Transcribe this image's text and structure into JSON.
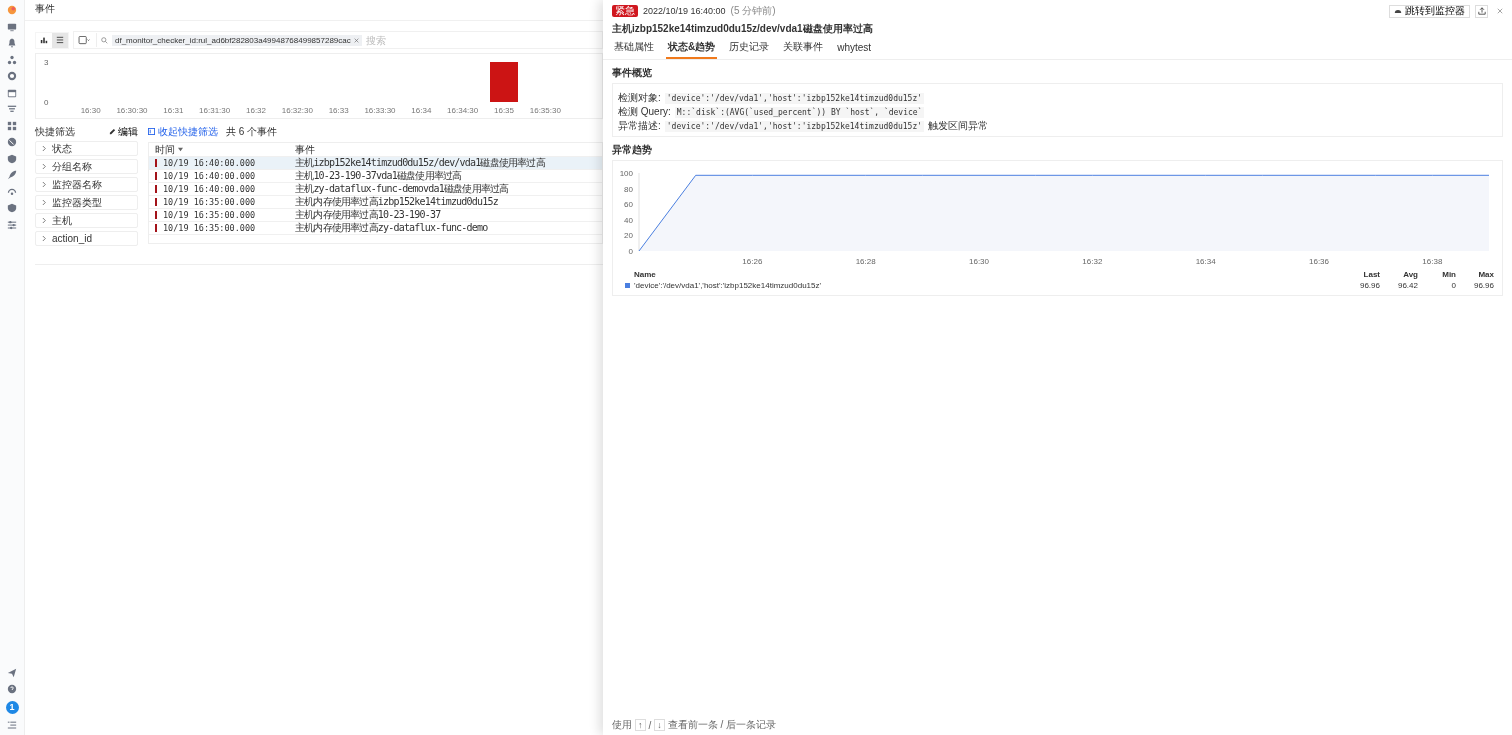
{
  "nav": {
    "badge": "1"
  },
  "header": {
    "title": "事件"
  },
  "toolbar": {
    "views": [
      {
        "kind": "chart",
        "selected": false
      },
      {
        "kind": "list",
        "selected": true
      }
    ],
    "filter_tag": "df_monitor_checker_id:rul_ad6bf282803a49948768499857289cac",
    "search_placeholder": "搜索"
  },
  "histogram": {
    "chart_data": {
      "type": "bar",
      "categories": [
        "16:30",
        "16:30:30",
        "16:31",
        "16:31:30",
        "16:32",
        "16:32:30",
        "16:33",
        "16:33:30",
        "16:34",
        "16:34:30",
        "16:35",
        "16:35:30"
      ],
      "series": [
        {
          "color": "#cc1414",
          "values": [
            0,
            0,
            0,
            0,
            0,
            0,
            0,
            0,
            0,
            0,
            3,
            0
          ]
        }
      ],
      "ylim": [
        0,
        3
      ],
      "yticks": [
        0,
        3
      ]
    }
  },
  "quick_filter": {
    "title": "快捷筛选",
    "edit": "编辑",
    "groups": [
      "状态",
      "分组名称",
      "监控器名称",
      "监控器类型",
      "主机",
      "action_id"
    ]
  },
  "events": {
    "collapse": "收起快捷筛选",
    "count": "共 6 个事件",
    "columns": [
      "时间",
      "事件"
    ],
    "rows": [
      {
        "time": "10/19 16:40:00.000",
        "event": "主机izbp152ke14timzud0du15z/dev/vda1磁盘使用率过高",
        "selected": true
      },
      {
        "time": "10/19 16:40:00.000",
        "event": "主机10-23-190-37vda1磁盘使用率过高",
        "selected": false
      },
      {
        "time": "10/19 16:40:00.000",
        "event": "主机zy-dataflux-func-demovda1磁盘使用率过高",
        "selected": false
      },
      {
        "time": "10/19 16:35:00.000",
        "event": "主机内存使用率过高izbp152ke14timzud0du15z",
        "selected": false
      },
      {
        "time": "10/19 16:35:00.000",
        "event": "主机内存使用率过高10-23-190-37",
        "selected": false
      },
      {
        "time": "10/19 16:35:00.000",
        "event": "主机内存使用率过高zy-dataflux-func-demo",
        "selected": false
      }
    ]
  },
  "drawer": {
    "level": "紧急",
    "time": "2022/10/19 16:40:00",
    "ago": "(5 分钟前)",
    "jump": "跳转到监控器",
    "title": "主机izbp152ke14timzud0du15z/dev/vda1磁盘使用率过高",
    "tabs": [
      {
        "label": "基础属性",
        "selected": false
      },
      {
        "label": "状态&趋势",
        "selected": true
      },
      {
        "label": "历史记录",
        "selected": false
      },
      {
        "label": "关联事件",
        "selected": false
      },
      {
        "label": "whytest",
        "selected": false
      }
    ],
    "overview": {
      "title": "事件概览",
      "rows": [
        {
          "label": "检测对象:",
          "code": "'device':'/dev/vda1','host':'izbp152ke14timzud0du15z'"
        },
        {
          "label": "检测 Query:",
          "code": "M::`disk`:(AVG(`used_percent`)) BY `host`, `device`"
        },
        {
          "label": "异常描述:",
          "code": "'device':'/dev/vda1','host':'izbp152ke14timzud0du15z'",
          "note": "触发区间异常"
        }
      ]
    },
    "trend": {
      "title": "异常趋势",
      "chart_data": {
        "type": "line",
        "categories": [
          null,
          null,
          "16:26",
          null,
          "16:28",
          null,
          "16:30",
          null,
          "16:32",
          null,
          "16:34",
          null,
          "16:36",
          null,
          "16:38",
          null
        ],
        "series": [
          {
            "name": "'device':'/dev/vda1','host':'izbp152ke14timzud0du15z'",
            "color": "#4a7fe0",
            "values": [
              0,
              97,
              97,
              97,
              97,
              97,
              97,
              97,
              97,
              97,
              97,
              97,
              97,
              97,
              97,
              97
            ]
          }
        ],
        "ylim": [
          0,
          100
        ],
        "yticks": [
          0,
          20,
          40,
          60,
          80,
          100
        ]
      },
      "legend": {
        "columns": [
          "Name",
          "Last",
          "Avg",
          "Min",
          "Max"
        ],
        "rows": [
          {
            "last": "96.96",
            "avg": "96.42",
            "min": "0",
            "max": "96.96"
          }
        ]
      }
    },
    "footer": {
      "prefix": "使用",
      "up": "↑",
      "sep": "/",
      "down": "↓",
      "text": "查看前一条 / 后一条记录"
    }
  }
}
